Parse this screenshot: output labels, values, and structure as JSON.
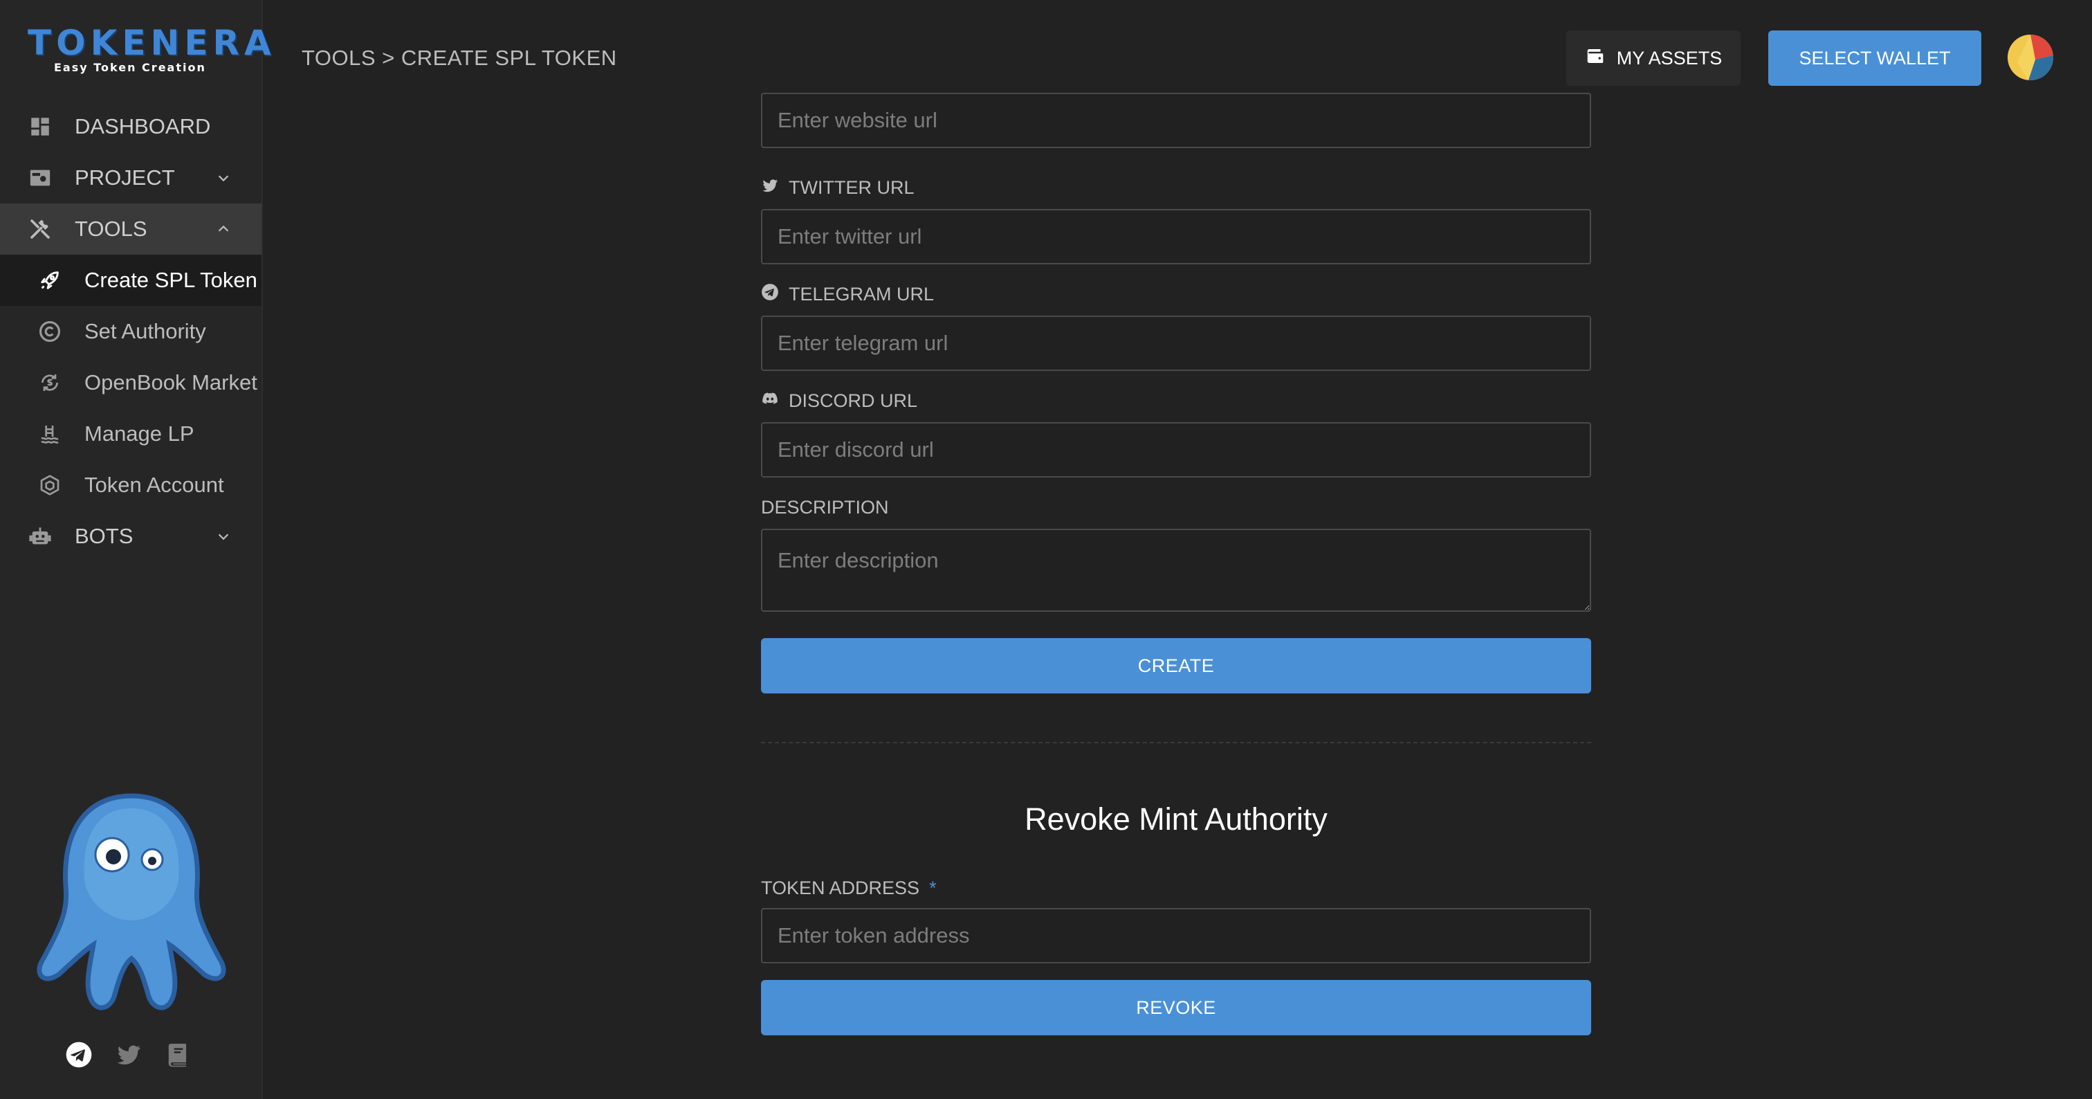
{
  "brand": {
    "name": "TOKENERA",
    "tagline": "Easy Token Creation"
  },
  "sidebar": {
    "items": [
      {
        "label": "DASHBOARD",
        "icon": "dashboard-icon"
      },
      {
        "label": "PROJECT",
        "icon": "project-icon",
        "expanded": false
      },
      {
        "label": "TOOLS",
        "icon": "tools-icon",
        "expanded": true
      },
      {
        "label": "BOTS",
        "icon": "robot-icon",
        "expanded": false
      }
    ],
    "tools_subitems": [
      {
        "label": "Create SPL Token",
        "icon": "rocket-icon",
        "active": true
      },
      {
        "label": "Set Authority",
        "icon": "copyright-icon"
      },
      {
        "label": "OpenBook Market",
        "icon": "market-icon"
      },
      {
        "label": "Manage LP",
        "icon": "pool-icon"
      },
      {
        "label": "Token Account",
        "icon": "cube-icon"
      }
    ],
    "social": [
      "telegram-icon",
      "twitter-icon",
      "book-icon"
    ]
  },
  "header": {
    "breadcrumb": "TOOLS > CREATE SPL TOKEN",
    "my_assets_label": "MY ASSETS",
    "select_wallet_label": "SELECT WALLET"
  },
  "form": {
    "website_placeholder": "Enter website url",
    "twitter_label": "TWITTER URL",
    "twitter_placeholder": "Enter twitter url",
    "telegram_label": "TELEGRAM URL",
    "telegram_placeholder": "Enter telegram url",
    "discord_label": "DISCORD URL",
    "discord_placeholder": "Enter discord url",
    "description_label": "DESCRIPTION",
    "description_placeholder": "Enter description",
    "create_label": "CREATE"
  },
  "revoke": {
    "title": "Revoke Mint Authority",
    "token_address_label": "TOKEN ADDRESS",
    "required_mark": "*",
    "token_address_placeholder": "Enter token address",
    "revoke_label": "REVOKE"
  },
  "colors": {
    "accent": "#4a90d6",
    "background": "#222222",
    "sidebar": "#262626"
  }
}
